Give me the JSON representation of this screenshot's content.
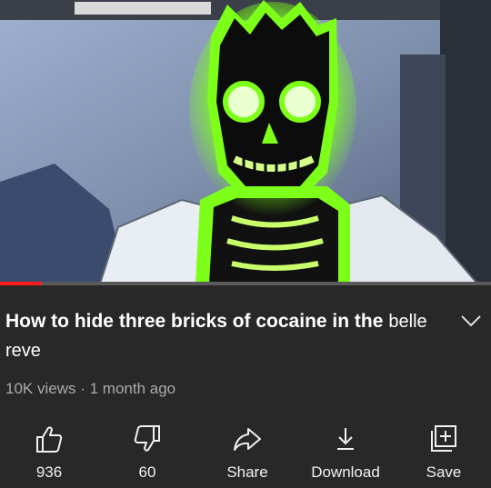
{
  "video": {
    "progress_fraction": 0.085,
    "description_image": "cartoon skeleton with glowing green outline in a white lab coat"
  },
  "title": {
    "main": "How to hide three bricks of cocaine in the",
    "extra": "belle reve"
  },
  "meta": {
    "views": "10K views",
    "separator": "·",
    "age": "1 month ago"
  },
  "actions": {
    "like": "936",
    "dislike": "60",
    "share": "Share",
    "download": "Download",
    "save": "Save"
  },
  "colors": {
    "background": "#282828",
    "progress_played": "#ff1c1c",
    "accent_glow": "#7dff1a"
  }
}
